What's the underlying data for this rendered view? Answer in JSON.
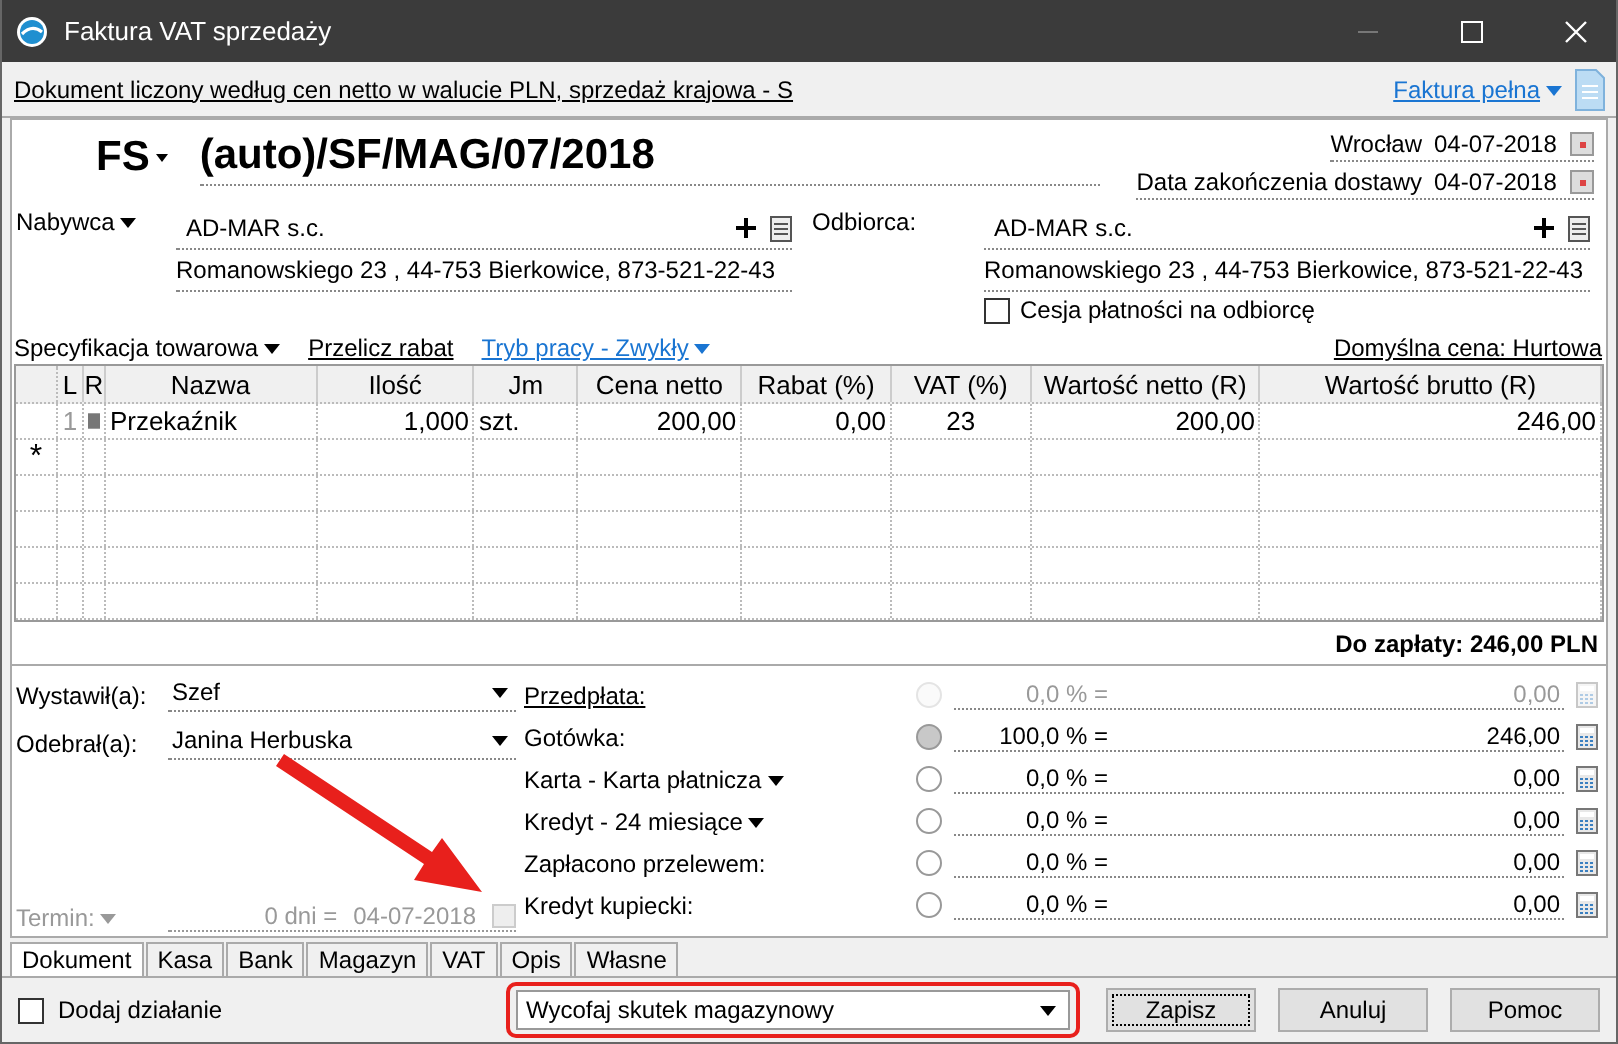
{
  "window": {
    "title": "Faktura VAT sprzedaży"
  },
  "info_bar": {
    "text": "Dokument liczony według cen netto w walucie PLN, sprzedaż krajowa - S",
    "mode_link": "Faktura pełna"
  },
  "header": {
    "doc_type": "FS",
    "number": "(auto)/SF/MAG/07/2018",
    "place": "Wrocław",
    "issue_date": "04-07-2018",
    "delivery_label": "Data zakończenia dostawy",
    "delivery_date": "04-07-2018"
  },
  "buyer": {
    "label": "Nabywca",
    "name": "AD-MAR s.c.",
    "address": "Romanowskiego 23 , 44-753 Bierkowice, 873-521-22-43"
  },
  "recipient": {
    "label": "Odbiorca:",
    "name": "AD-MAR s.c.",
    "address": "Romanowskiego 23 , 44-753 Bierkowice, 873-521-22-43",
    "cession": {
      "label": "Cesja płatności na odbiorcę",
      "checked": false
    }
  },
  "toolbar": {
    "specification": "Specyfikacja towarowa",
    "recalc": "Przelicz rabat",
    "work_mode": "Tryb pracy - Zwykły",
    "default_price": "Domyślna cena: Hurtowa"
  },
  "table": {
    "columns": [
      "L",
      "R",
      "Nazwa",
      "Ilość",
      "Jm",
      "Cena netto",
      "Rabat (%)",
      "VAT (%)",
      "Wartość netto (R)",
      "Wartość brutto (R)"
    ],
    "rows": [
      [
        "1",
        "",
        "Przekaźnik",
        "1,000",
        "szt.",
        "200,00",
        "0,00",
        "23",
        "200,00",
        "246,00"
      ]
    ],
    "new_row_marker": "*"
  },
  "total": "Do zapłaty: 246,00 PLN",
  "people": [
    {
      "label": "Wystawił(a):",
      "value": "Szef"
    },
    {
      "label": "Odebrał(a):",
      "value": "Janina Herbuska"
    }
  ],
  "term": {
    "label": "Termin:",
    "days": "0 dni =",
    "date": "04-07-2018",
    "disabled": true
  },
  "payments": [
    {
      "label": "Przedpłata:",
      "kind": "link",
      "percent": "0,0 % =",
      "amount": "0,00",
      "disabled": true,
      "selected": false
    },
    {
      "label": "Gotówka:",
      "kind": "plain",
      "percent": "100,0 % =",
      "amount": "246,00",
      "disabled": false,
      "selected": true
    },
    {
      "label": "Karta - Karta płatnicza",
      "kind": "dropdown",
      "percent": "0,0 % =",
      "amount": "0,00",
      "disabled": false,
      "selected": false
    },
    {
      "label": "Kredyt - 24 miesiące",
      "kind": "dropdown",
      "percent": "0,0 % =",
      "amount": "0,00",
      "disabled": false,
      "selected": false
    },
    {
      "label": "Zapłacono przelewem:",
      "kind": "plain",
      "percent": "0,0 % =",
      "amount": "0,00",
      "disabled": false,
      "selected": false
    },
    {
      "label": "Kredyt kupiecki:",
      "kind": "plain",
      "percent": "0,0 % =",
      "amount": "0,00",
      "disabled": false,
      "selected": false
    }
  ],
  "tabs": [
    {
      "label": "Dokument",
      "selected": true
    },
    {
      "label": "Kasa",
      "selected": false
    },
    {
      "label": "Bank",
      "selected": false
    },
    {
      "label": "Magazyn",
      "selected": false
    },
    {
      "label": "VAT",
      "selected": false
    },
    {
      "label": "Opis",
      "selected": false
    },
    {
      "label": "Własne",
      "selected": false
    }
  ],
  "bottom": {
    "add_action": {
      "label": "Dodaj działanie",
      "checked": false
    },
    "action": "Wycofaj skutek magazynowy",
    "buttons": [
      "Zapisz",
      "Anuluj",
      "Pomoc"
    ]
  }
}
